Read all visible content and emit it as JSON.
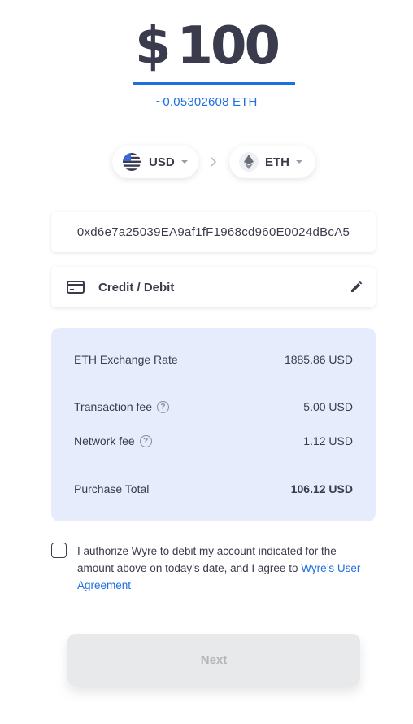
{
  "amount": {
    "currency_symbol": "$",
    "value": "100",
    "eth_estimate": "~0.05302608 ETH"
  },
  "currency_selector": {
    "from": {
      "code": "USD",
      "icon": "us-flag-icon"
    },
    "to": {
      "code": "ETH",
      "icon": "ethereum-icon"
    }
  },
  "wallet_address": "0xd6e7a25039EA9af1fF1968cd960E0024dBcA5",
  "payment_method": {
    "label": "Credit / Debit",
    "icon": "credit-card-icon",
    "edit_icon": "pencil-icon"
  },
  "summary": {
    "exchange_rate": {
      "label": "ETH Exchange Rate",
      "value": "1885.86 USD"
    },
    "transaction_fee": {
      "label": "Transaction fee",
      "value": "5.00 USD",
      "help": "?"
    },
    "network_fee": {
      "label": "Network fee",
      "value": "1.12 USD",
      "help": "?"
    },
    "total": {
      "label": "Purchase Total",
      "value": "106.12 USD"
    }
  },
  "consent": {
    "text": "I authorize Wyre to debit my account indicated for the amount above on today’s date, and I agree to ",
    "link_text": "Wyre’s User Agreement",
    "checked": false
  },
  "next_button": {
    "label": "Next",
    "disabled": true
  },
  "colors": {
    "accent": "#1e6fe0",
    "summary_background": "#e6ecfb",
    "text": "#3b3c4a"
  }
}
